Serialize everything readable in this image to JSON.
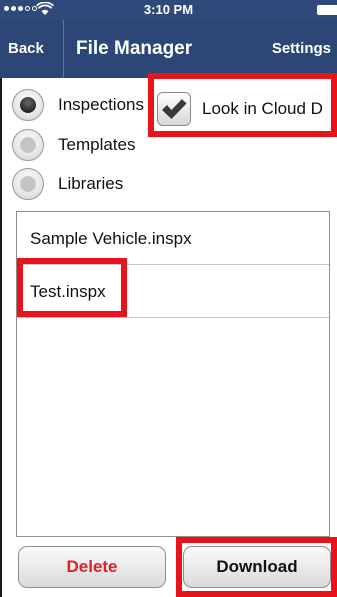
{
  "status_bar": {
    "time": "3:10 PM",
    "signal_icon": "signal-dots-icon",
    "wifi_icon": "wifi-icon",
    "battery_icon": "battery-icon"
  },
  "nav": {
    "back_label": "Back",
    "title": "File Manager",
    "settings_label": "Settings"
  },
  "options": [
    {
      "label": "Inspections",
      "selected": true
    },
    {
      "label": "Templates",
      "selected": false
    },
    {
      "label": "Libraries",
      "selected": false
    }
  ],
  "cloud": {
    "label": "Look in Cloud D",
    "checked": true,
    "icon": "checkmark-icon"
  },
  "files": [
    {
      "name": "Sample Vehicle.inspx"
    },
    {
      "name": "Test.inspx"
    }
  ],
  "buttons": {
    "delete_label": "Delete",
    "download_label": "Download"
  },
  "colors": {
    "nav_background": "#2c4676",
    "delete_text": "#e0202a",
    "highlight": "#e8141b"
  }
}
